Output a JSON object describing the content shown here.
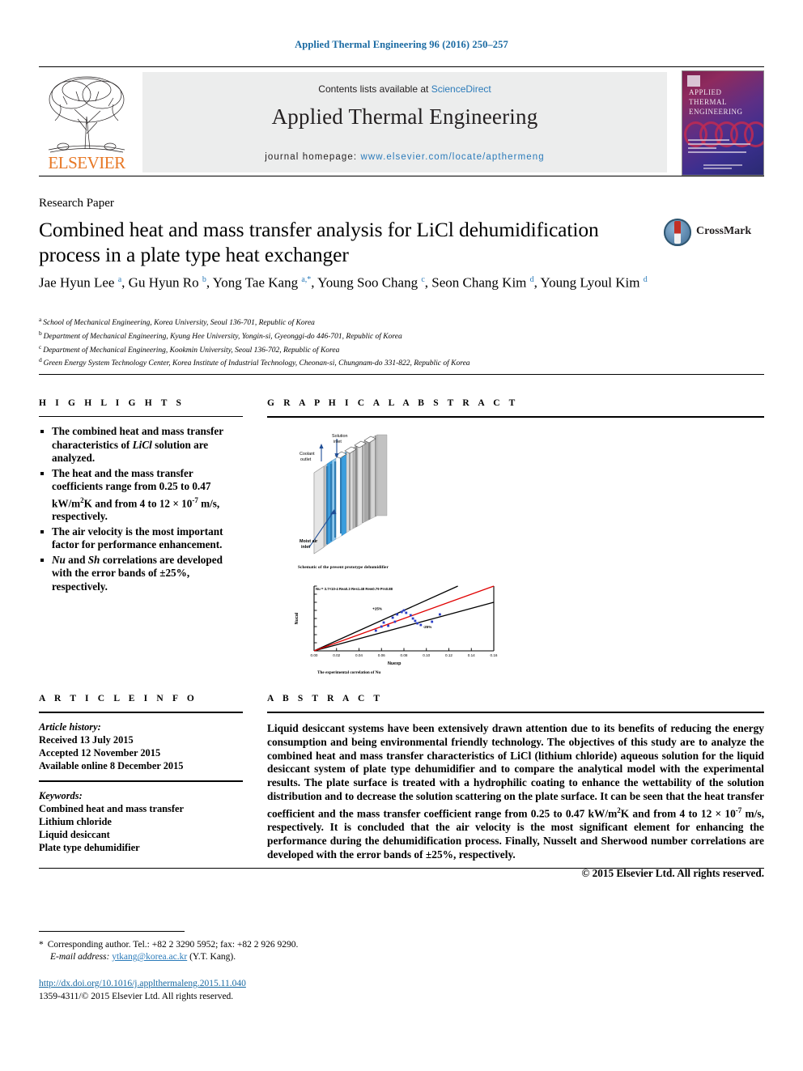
{
  "running_head": "Applied Thermal Engineering 96 (2016) 250–257",
  "masthead": {
    "contents_prefix": "Contents lists available at ",
    "sciencedirect": "ScienceDirect",
    "journal_title": "Applied Thermal Engineering",
    "homepage_prefix": "journal homepage: ",
    "homepage_url": "www.elsevier.com/locate/apthermeng",
    "publisher": "ELSEVIER",
    "cover_title": "APPLIED THERMAL ENGINEERING"
  },
  "article": {
    "type": "Research Paper",
    "title": "Combined heat and mass transfer analysis for LiCl dehumidification process in a plate type heat exchanger",
    "crossmark_label": "CrossMark",
    "authors": [
      {
        "name": "Jae Hyun Lee",
        "sup": "a"
      },
      {
        "name": "Gu Hyun Ro",
        "sup": "b"
      },
      {
        "name": "Yong Tae Kang",
        "sup": "a,*"
      },
      {
        "name": "Young Soo Chang",
        "sup": "c"
      },
      {
        "name": "Seon Chang Kim",
        "sup": "d"
      },
      {
        "name": "Young Lyoul Kim",
        "sup": "d"
      }
    ],
    "affiliations": [
      {
        "mark": "a",
        "text": "School of Mechanical Engineering, Korea University, Seoul 136-701, Republic of Korea"
      },
      {
        "mark": "b",
        "text": "Department of Mechanical Engineering, Kyung Hee University, Yongin-si, Gyeonggi-do 446-701, Republic of Korea"
      },
      {
        "mark": "c",
        "text": "Department of Mechanical Engineering, Kookmin University, Seoul 136-702, Republic of Korea"
      },
      {
        "mark": "d",
        "text": "Green Energy System Technology Center, Korea Institute of Industrial Technology, Cheonan-si, Chungnam-do 331-822, Republic of Korea"
      }
    ]
  },
  "highlights": {
    "heading": "H I G H L I G H T S",
    "items": [
      "The combined heat and mass transfer characteristics of LiCl solution are analyzed.",
      "The heat and the mass transfer coefficients range from 0.25 to 0.47 kW/m2K and from 4 to 12 × 10-7 m/s, respectively.",
      "The air velocity is the most important factor for performance enhancement.",
      "Nu and Sh correlations are developed with the error bands of ±25%, respectively."
    ]
  },
  "graphical_abstract": {
    "heading": "G R A P H I C A L   A B S T R A C T",
    "schematic_caption": "Schematic of the present prototype dehumidifier",
    "schematic_labels": {
      "solution_inlet": "Solution inlet",
      "coolant_outlet": "Coolant outlet",
      "moist_air_inlet": "Moist air inlet"
    },
    "chart_caption": "The experimental correlation of Nu"
  },
  "chart_data": {
    "type": "scatter",
    "title": "The experimental correlation of Nu",
    "xlabel": "Nuexp",
    "ylabel": "Nucal",
    "annotation": "Nu = 3.7×10-4 Rea0.3 Res1.48 Rew0.79 Prs0.88",
    "xlim": [
      0.0,
      0.16
    ],
    "ylim": [
      0.0,
      0.16
    ],
    "xticks": [
      0.0,
      0.02,
      0.04,
      0.06,
      0.08,
      0.1,
      0.12,
      0.14,
      0.16
    ],
    "xticklabels": [
      "0.00",
      "0.02",
      "0.04",
      "0.06",
      "0.08",
      "0.10",
      "0.12",
      "0.14",
      "0.16"
    ],
    "yticks": [
      0.0,
      0.02,
      0.04,
      0.06,
      0.08,
      0.1,
      0.12,
      0.14,
      0.16
    ],
    "grid": false,
    "legend": false,
    "error_band_labels": [
      "+25%",
      "-25%"
    ],
    "reference_line": {
      "name": "parity",
      "color": "#e00000",
      "slope": 1.0
    },
    "band_lines": [
      {
        "name": "+25%",
        "color": "#000000",
        "slope": 1.25
      },
      {
        "name": "-25%",
        "color": "#000000",
        "slope": 0.75
      }
    ],
    "points": [
      {
        "x": 0.055,
        "y": 0.05
      },
      {
        "x": 0.06,
        "y": 0.06
      },
      {
        "x": 0.062,
        "y": 0.07
      },
      {
        "x": 0.07,
        "y": 0.082
      },
      {
        "x": 0.074,
        "y": 0.09
      },
      {
        "x": 0.078,
        "y": 0.096
      },
      {
        "x": 0.08,
        "y": 0.1
      },
      {
        "x": 0.082,
        "y": 0.094
      },
      {
        "x": 0.086,
        "y": 0.088
      },
      {
        "x": 0.088,
        "y": 0.08
      },
      {
        "x": 0.09,
        "y": 0.074
      },
      {
        "x": 0.092,
        "y": 0.068
      },
      {
        "x": 0.095,
        "y": 0.064
      },
      {
        "x": 0.105,
        "y": 0.072
      },
      {
        "x": 0.112,
        "y": 0.09
      },
      {
        "x": 0.066,
        "y": 0.062
      },
      {
        "x": 0.072,
        "y": 0.072
      }
    ],
    "point_color": "#2a3ec8"
  },
  "article_info": {
    "heading": "A R T I C L E   I N F O",
    "history_label": "Article history:",
    "history": [
      "Received 13 July 2015",
      "Accepted 12 November 2015",
      "Available online 8 December 2015"
    ],
    "keywords_label": "Keywords:",
    "keywords": [
      "Combined heat and mass transfer",
      "Lithium chloride",
      "Liquid desiccant",
      "Plate type dehumidifier"
    ]
  },
  "abstract": {
    "heading": "A B S T R A C T",
    "text": "Liquid desiccant systems have been extensively drawn attention due to its benefits of reducing the energy consumption and being environmental friendly technology. The objectives of this study are to analyze the combined heat and mass transfer characteristics of LiCl (lithium chloride) aqueous solution for the liquid desiccant system of plate type dehumidifier and to compare the analytical model with the experimental results. The plate surface is treated with a hydrophilic coating to enhance the wettability of the solution distribution and to decrease the solution scattering on the plate surface. It can be seen that the heat transfer coefficient and the mass transfer coefficient range from 0.25 to 0.47 kW/m2K and from 4 to 12 × 10-7 m/s, respectively. It is concluded that the air velocity is the most significant element for enhancing the performance during the dehumidification process. Finally, Nusselt and Sherwood number correlations are developed with the error bands of ±25%, respectively.",
    "copyright": "© 2015 Elsevier Ltd. All rights reserved."
  },
  "footer": {
    "corresponding_star": "*",
    "corresponding_text": "Corresponding author. Tel.: +82 2 3290 5952; fax: +82 2 926 9290.",
    "email_label": "E-mail address:",
    "email": "ytkang@korea.ac.kr",
    "email_owner": "(Y.T. Kang).",
    "doi": "http://dx.doi.org/10.1016/j.applthermaleng.2015.11.040",
    "issn": "1359-4311/© 2015 Elsevier Ltd. All rights reserved."
  }
}
